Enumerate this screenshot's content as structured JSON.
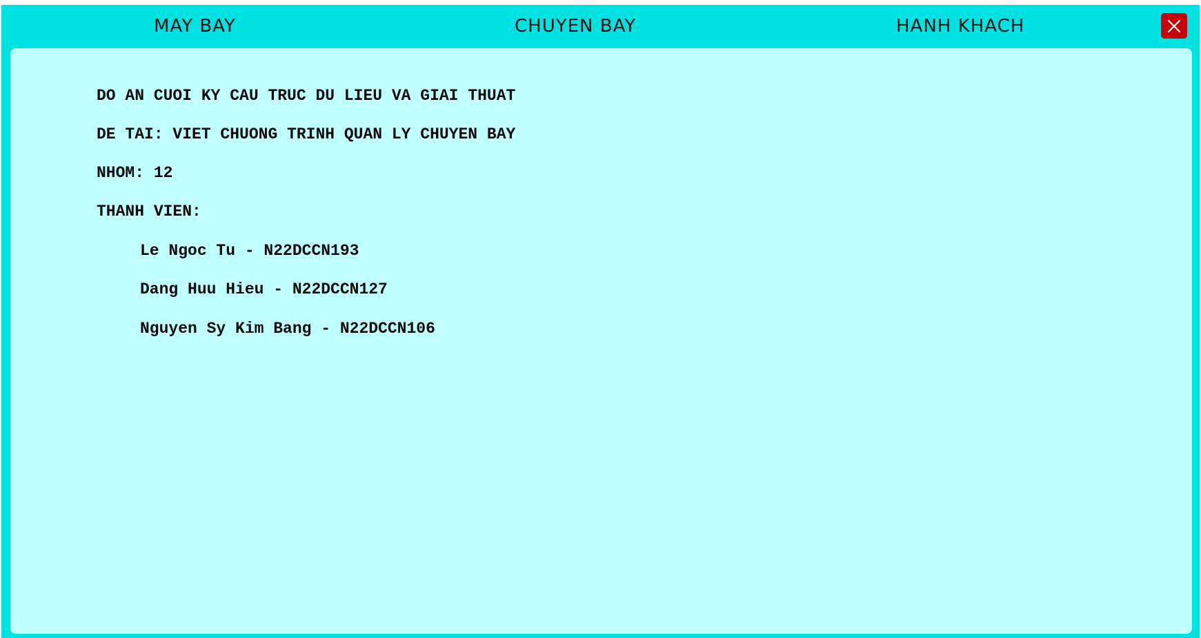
{
  "nav": {
    "tabs": [
      {
        "label": "MAY BAY"
      },
      {
        "label": "CHUYEN BAY"
      },
      {
        "label": "HANH KHACH"
      }
    ],
    "close_icon": "close-icon"
  },
  "info": {
    "course_title": "DO AN CUOI KY CAU TRUC DU LIEU VA GIAI THUAT",
    "topic": "DE TAI: VIET CHUONG TRINH QUAN LY CHUYEN BAY",
    "group": "NHOM: 12",
    "members_heading": "THANH VIEN:",
    "members": [
      "Le Ngoc Tu - N22DCCN193",
      "Dang Huu Hieu - N22DCCN127",
      "Nguyen Sy Kim Bang - N22DCCN106"
    ]
  },
  "colors": {
    "frame": "#00e1e1",
    "panel": "#c0ffff",
    "close_button": "#c8000a"
  }
}
